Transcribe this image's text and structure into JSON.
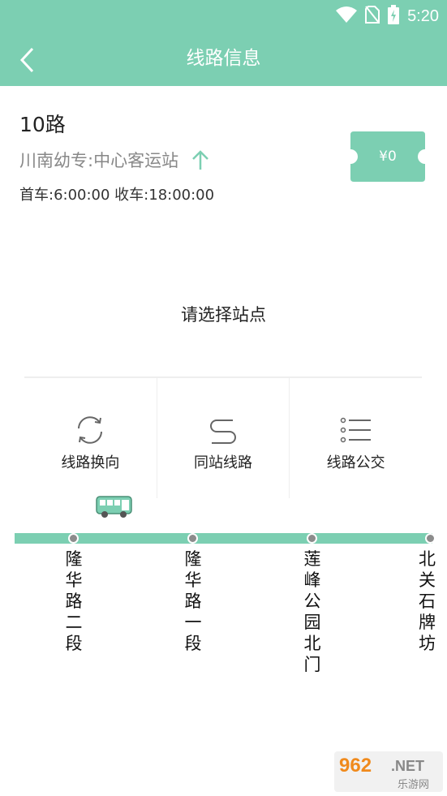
{
  "status": {
    "time": "5:20"
  },
  "header": {
    "title": "线路信息"
  },
  "route": {
    "name": "10路",
    "direction": "川南幼专:中心客运站",
    "schedule": "首车:6:00:00 收车:18:00:00",
    "fare": "¥0"
  },
  "prompt": "请选择站点",
  "tools": [
    {
      "label": "线路换向",
      "icon": "reverse-icon"
    },
    {
      "label": "同站线路",
      "icon": "route-s-icon"
    },
    {
      "label": "线路公交",
      "icon": "list-icon"
    }
  ],
  "stations": [
    "隆华路二段",
    "隆华路一段",
    "莲峰公园北门",
    "北关石牌坊"
  ],
  "watermark": {
    "big": "962",
    "net": ".NET",
    "small": "乐游网"
  },
  "colors": {
    "accent": "#7ccfb2",
    "dot": "#8c8c8c"
  }
}
